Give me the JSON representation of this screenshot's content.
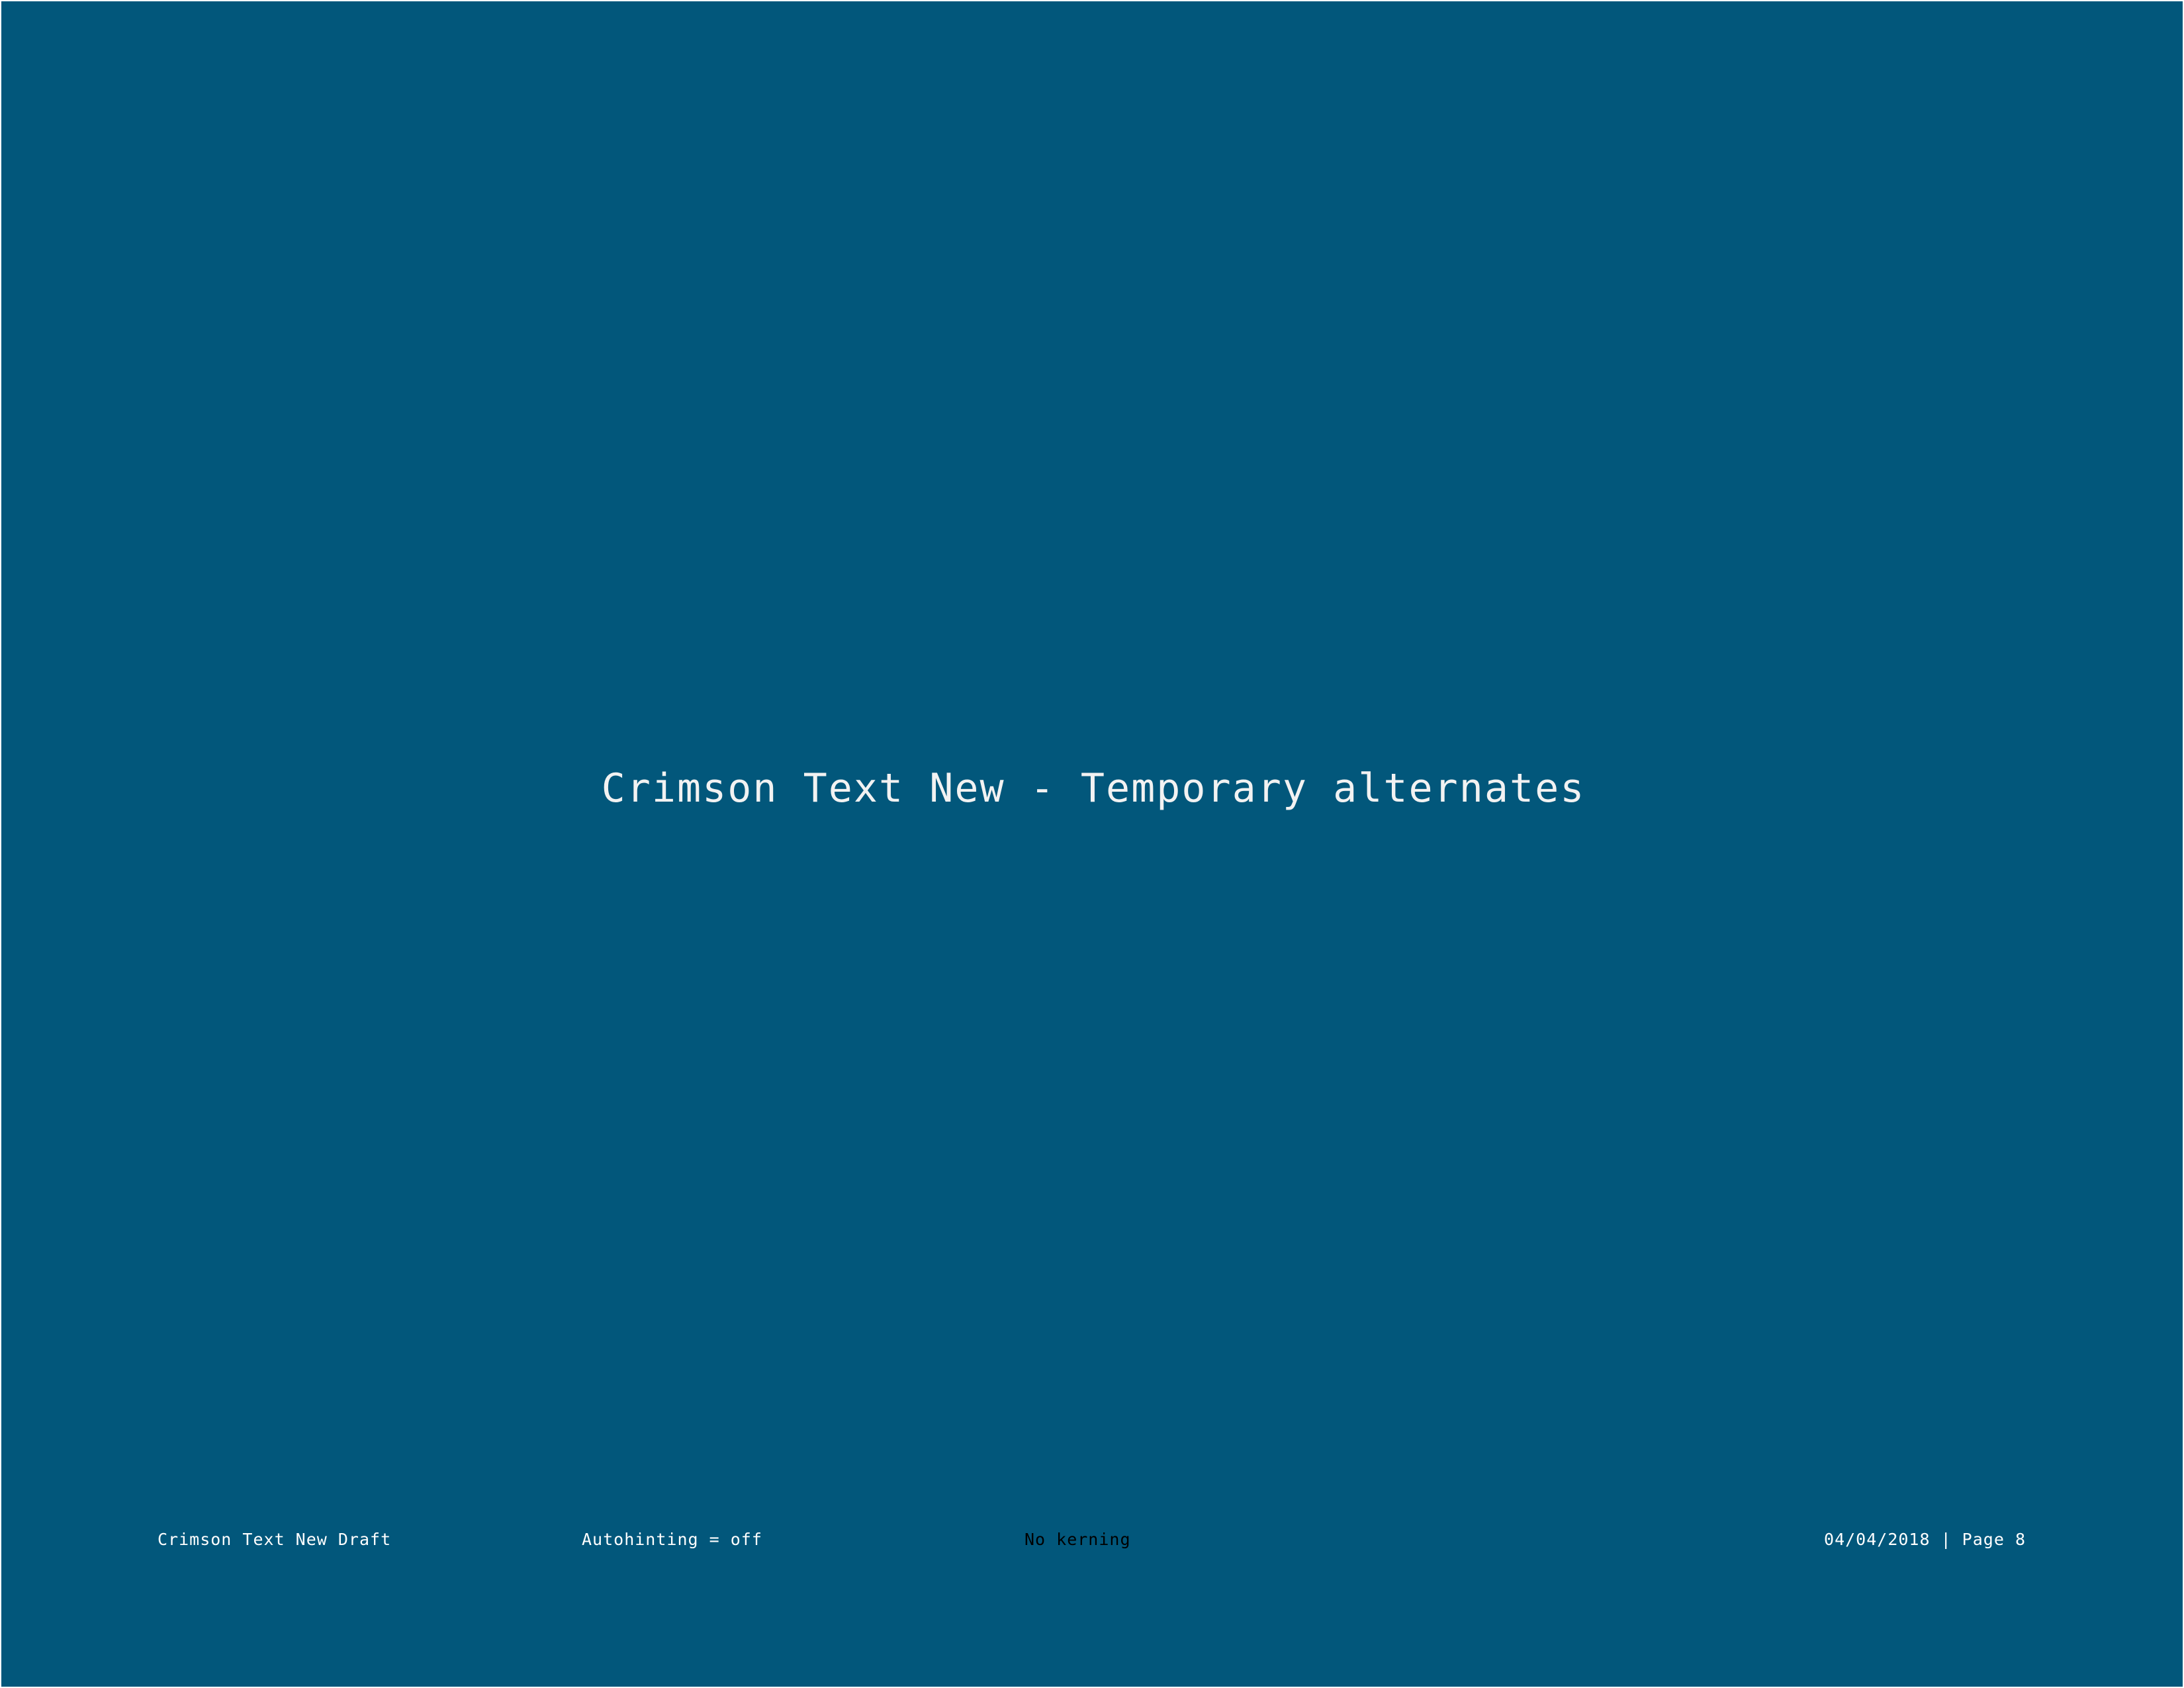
{
  "slide": {
    "title": "Crimson Text New - Temporary alternates",
    "background_color": "#02577b",
    "text_color": "#ffffff"
  },
  "footer": {
    "document_name": "Crimson Text New Draft",
    "autohinting": "Autohinting = off",
    "kerning": "No kerning",
    "date_page": "04/04/2018 | Page 8"
  }
}
